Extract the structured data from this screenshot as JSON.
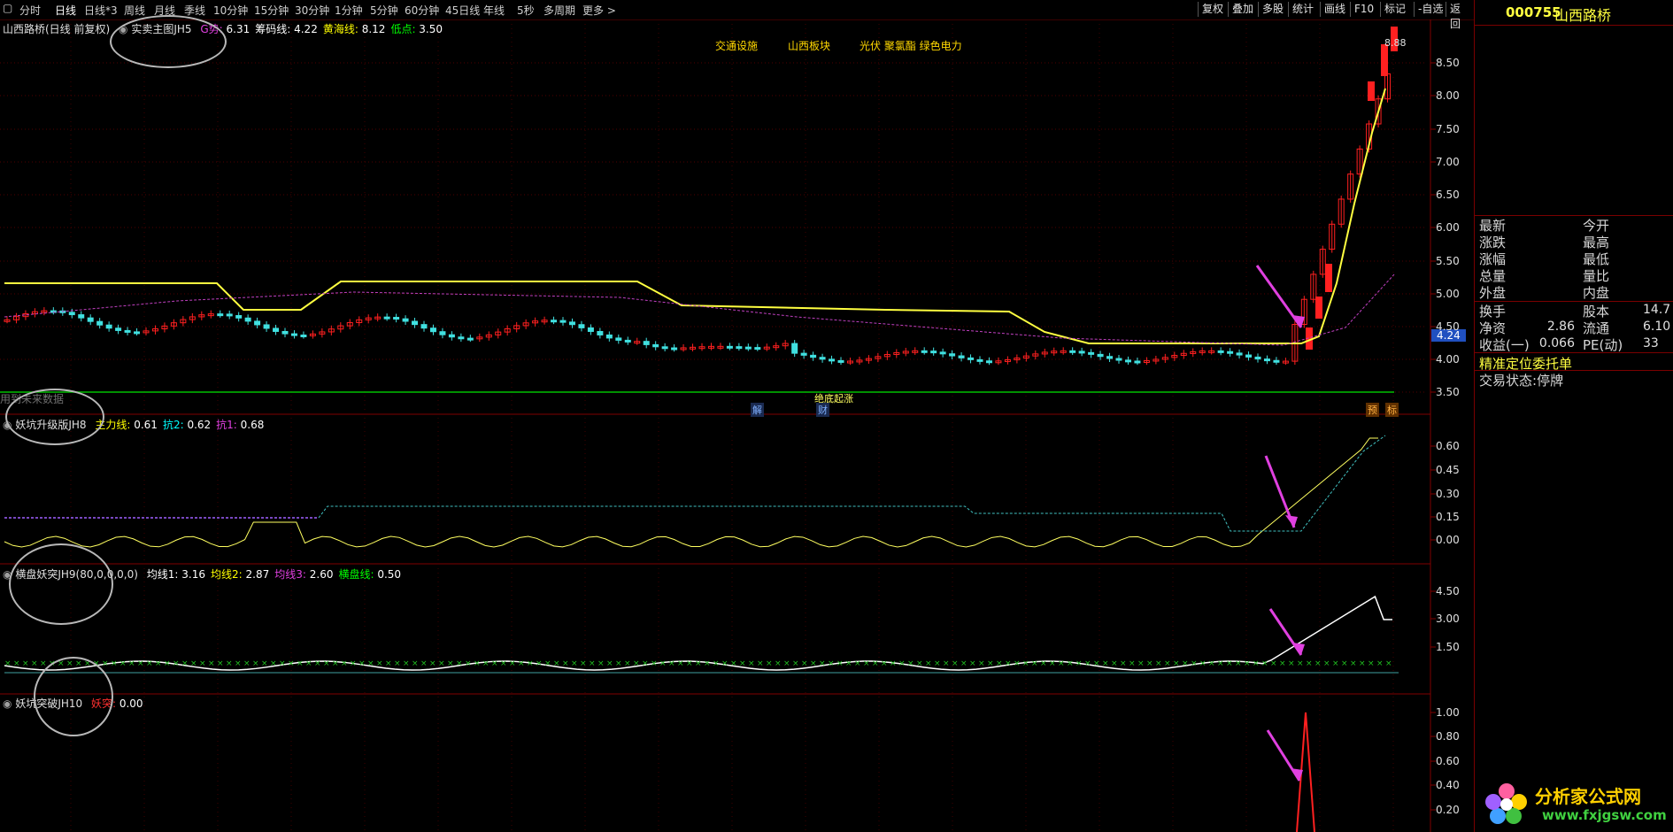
{
  "toolbar": {
    "tabs": [
      "分时",
      "日线",
      "日线*3",
      "周线",
      "月线",
      "季线",
      "10分钟",
      "15分钟",
      "30分钟",
      "1分钟",
      "5分钟",
      "60分钟",
      "45日线",
      "年线",
      "5秒",
      "多周期",
      "更多 >"
    ],
    "active_tab": "日线",
    "right_buttons": [
      "复权",
      "叠加",
      "多股",
      "统计",
      "画线",
      "F10",
      "标记",
      "-自选",
      "返回"
    ]
  },
  "main_panel": {
    "title": "山西路桥(日线 前复权)",
    "indicator": "实卖主图JH5",
    "indicator_values": [
      {
        "label": "G势",
        "value": "6.31",
        "color": "#e040e0"
      },
      {
        "label": "筹码线",
        "value": "4.22",
        "color": "#ffffff"
      },
      {
        "label": "黄海线",
        "value": "8.12",
        "color": "#ffff00"
      },
      {
        "label": "低点",
        "value": "3.50",
        "color": "#00ff00"
      }
    ],
    "sectors": [
      "交通设施",
      "山西板块",
      "光伏 聚氯酯 绿色电力"
    ],
    "y_ticks": [
      "8.50",
      "8.00",
      "7.50",
      "7.00",
      "6.50",
      "6.00",
      "5.50",
      "5.00",
      "4.50",
      "4.00",
      "3.50"
    ],
    "price_tag": "4.24",
    "high_label": "8.88",
    "bottom_note": "用到未来数据",
    "chart_text": "绝底起涨",
    "markers": [
      {
        "label": "解",
        "color": "#4080ff"
      },
      {
        "label": "财",
        "color": "#4080ff"
      },
      {
        "label": "预",
        "color": "#ff8000"
      },
      {
        "label": "标",
        "color": "#ff8000"
      }
    ]
  },
  "panel2": {
    "indicator": "妖坑升级版JH8",
    "values": [
      {
        "label": "主力线",
        "value": "0.61",
        "color": "#ffff00"
      },
      {
        "label": "抗2",
        "value": "0.62",
        "color": "#00ffff"
      },
      {
        "label": "抗1",
        "value": "0.68",
        "color": "#e040e0"
      }
    ],
    "y_ticks": [
      "0.60",
      "0.45",
      "0.30",
      "0.15",
      "0.00"
    ]
  },
  "panel3": {
    "indicator": "横盘妖突JH9(80,0,0,0,0)",
    "values": [
      {
        "label": "均线1",
        "value": "3.16",
        "color": "#ffffff"
      },
      {
        "label": "均线2",
        "value": "2.87",
        "color": "#ffff00"
      },
      {
        "label": "均线3",
        "value": "2.60",
        "color": "#e040e0"
      },
      {
        "label": "横盘线",
        "value": "0.50",
        "color": "#00ff00"
      }
    ],
    "y_ticks": [
      "4.50",
      "3.00",
      "1.50"
    ]
  },
  "panel4": {
    "indicator": "妖坑突破JH10",
    "values": [
      {
        "label": "妖突",
        "value": "0.00",
        "color": "#ff3030"
      }
    ],
    "y_ticks": [
      "1.00",
      "0.80",
      "0.60",
      "0.40",
      "0.20"
    ]
  },
  "stock": {
    "code": "000755",
    "name": "山西路桥"
  },
  "quote": {
    "left_labels": [
      "最新",
      "涨跌",
      "涨幅",
      "总量",
      "外盘"
    ],
    "right_labels": [
      "今开",
      "最高",
      "最低",
      "量比",
      "内盘"
    ],
    "rows2": [
      {
        "l": "换手",
        "lv": "",
        "r": "股本",
        "rv": "14.7"
      },
      {
        "l": "净资",
        "lv": "2.86",
        "r": "流通",
        "rv": "6.10"
      },
      {
        "l": "收益(一)",
        "lv": "0.066",
        "r": "PE(动)",
        "rv": "33"
      }
    ],
    "order_link": "精准定位委托单",
    "status_label": "交易状态:",
    "status_value": "停牌"
  },
  "watermark": {
    "brand": "分析家公式网",
    "url": "www.fxjgsw.com"
  },
  "colors": {
    "up": "#ff2020",
    "down": "#40e0e0",
    "yellow_line": "#ffff40",
    "ma_purple": "#c040c0",
    "axis_red": "#800000",
    "annotation_arrow": "#e040e0"
  }
}
